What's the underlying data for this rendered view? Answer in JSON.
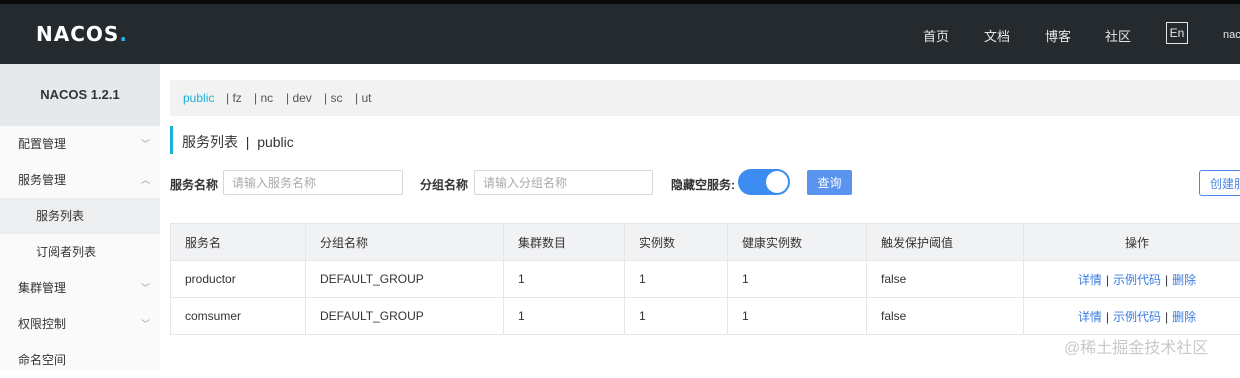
{
  "header": {
    "logo": "NACOS",
    "logo_dot": ".",
    "nav": [
      "首页",
      "文档",
      "博客",
      "社区"
    ],
    "lang": "En",
    "user_fragment": "nac"
  },
  "sidebar": {
    "title": "NACOS 1.2.1",
    "items": [
      {
        "label": "配置管理",
        "chevron": "﹀"
      },
      {
        "label": "服务管理",
        "chevron": "︿"
      },
      {
        "label": "服务列表"
      },
      {
        "label": "订阅者列表"
      },
      {
        "label": "集群管理",
        "chevron": "﹀"
      },
      {
        "label": "权限控制",
        "chevron": "﹀"
      },
      {
        "label": "命名空间"
      }
    ]
  },
  "namespaces": [
    "public",
    "| fz",
    "| nc",
    "| dev",
    "| sc",
    "| ut"
  ],
  "page": {
    "title": "服务列表",
    "separator": "|",
    "namespace": "public"
  },
  "filters": {
    "service_name_label": "服务名称",
    "service_name_placeholder": "请输入服务名称",
    "group_name_label": "分组名称",
    "group_name_placeholder": "请输入分组名称",
    "hide_empty_label": "隐藏空服务:",
    "hide_empty_on": true,
    "query_label": "查询",
    "create_label": "创建服务"
  },
  "table": {
    "headers": [
      "服务名",
      "分组名称",
      "集群数目",
      "实例数",
      "健康实例数",
      "触发保护阈值",
      "操作"
    ],
    "rows": [
      {
        "name": "productor",
        "group": "DEFAULT_GROUP",
        "clusters": "1",
        "instances": "1",
        "healthy": "1",
        "threshold": "false"
      },
      {
        "name": "comsumer",
        "group": "DEFAULT_GROUP",
        "clusters": "1",
        "instances": "1",
        "healthy": "1",
        "threshold": "false"
      }
    ],
    "ops": {
      "detail": "详情",
      "sample": "示例代码",
      "delete": "删除",
      "sep": "|"
    }
  },
  "watermark": "@稀土掘金技术社区",
  "colors": {
    "accent": "#1ab0d8",
    "primary": "#3c8cf1",
    "topbar": "#252a2f"
  }
}
